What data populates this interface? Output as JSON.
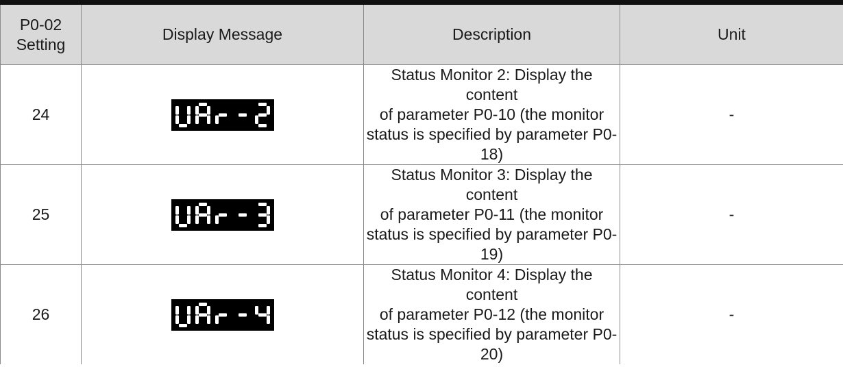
{
  "header": {
    "col_setting_line1": "P0-02",
    "col_setting_line2": "Setting",
    "col_display": "Display Message",
    "col_description": "Description",
    "col_unit": "Unit"
  },
  "rows": [
    {
      "setting": "24",
      "display_text": "UAr-2",
      "description_lines": [
        "Status Monitor 2: Display the content",
        "of parameter P0-10 (the monitor",
        "status is specified by parameter P0-",
        "18)"
      ],
      "unit": "-"
    },
    {
      "setting": "25",
      "display_text": "UAr-3",
      "description_lines": [
        "Status Monitor 3: Display the content",
        "of parameter P0-11 (the monitor",
        "status is specified by parameter P0-",
        "19)"
      ],
      "unit": "-"
    },
    {
      "setting": "26",
      "display_text": "UAr-4",
      "description_lines": [
        "Status Monitor 4: Display the content",
        "of parameter P0-12 (the monitor",
        "status is specified by parameter P0-",
        "20)"
      ],
      "unit": "-"
    }
  ],
  "colors": {
    "header_bg": "#d9d9d9",
    "lcd_bg": "#000000",
    "lcd_segment": "#ffffff",
    "rule": "#111111"
  }
}
